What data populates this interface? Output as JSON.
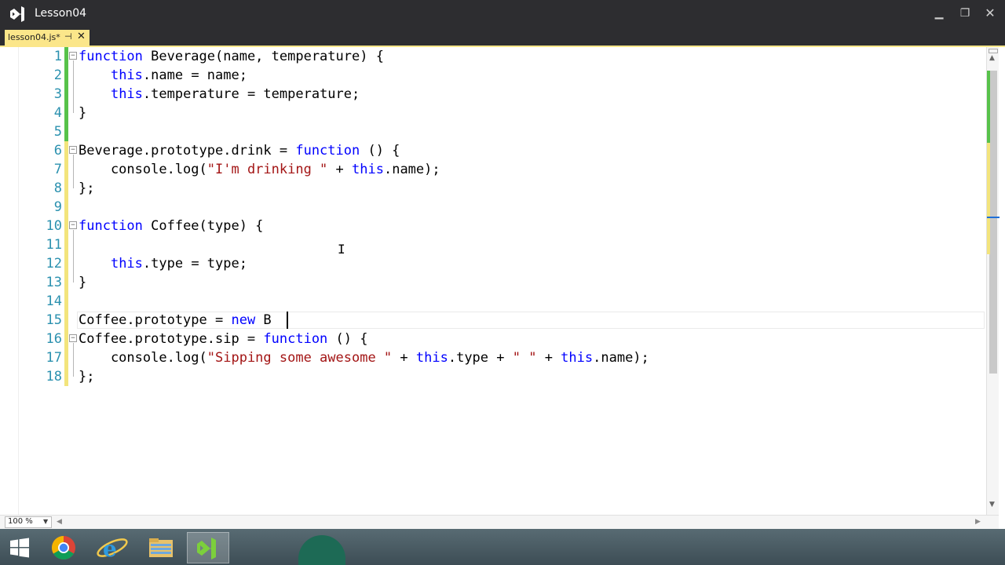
{
  "window": {
    "title": "Lesson04",
    "minimize_glyph": "▁",
    "maximize_glyph": "❐",
    "close_glyph": "✕"
  },
  "tab": {
    "label": "lesson04.js*",
    "pin_glyph": "⊣",
    "close_glyph": "✕"
  },
  "editor": {
    "lines": [
      {
        "n": "1",
        "code": "function Beverage(name, temperature) {"
      },
      {
        "n": "2",
        "code": "    this.name = name;"
      },
      {
        "n": "3",
        "code": "    this.temperature = temperature;"
      },
      {
        "n": "4",
        "code": "}"
      },
      {
        "n": "5",
        "code": ""
      },
      {
        "n": "6",
        "code": "Beverage.prototype.drink = function () {"
      },
      {
        "n": "7",
        "code": "    console.log(\"I'm drinking \" + this.name);"
      },
      {
        "n": "8",
        "code": "};"
      },
      {
        "n": "9",
        "code": ""
      },
      {
        "n": "10",
        "code": "function Coffee(type) {"
      },
      {
        "n": "11",
        "code": ""
      },
      {
        "n": "12",
        "code": "    this.type = type;"
      },
      {
        "n": "13",
        "code": "}"
      },
      {
        "n": "14",
        "code": ""
      },
      {
        "n": "15",
        "code": "Coffee.prototype = new B"
      },
      {
        "n": "16",
        "code": "Coffee.prototype.sip = function () {"
      },
      {
        "n": "17",
        "code": "    console.log(\"Sipping some awesome \" + this.type + \" \" + this.name);"
      },
      {
        "n": "18",
        "code": "};"
      }
    ],
    "fold_glyph": "−"
  },
  "zoom": {
    "value": "100 %"
  },
  "taskbar": {
    "items": [
      "start-button",
      "chrome",
      "internet-explorer",
      "file-explorer",
      "visual-studio"
    ]
  },
  "colors": {
    "keyword": "#0000ff",
    "string": "#a31515",
    "line_number": "#2b91af",
    "changed_saved": "#57c24a",
    "changed_unsaved": "#f3e47c",
    "tab_active": "#fbe68a",
    "titlebar": "#2d2d30"
  }
}
